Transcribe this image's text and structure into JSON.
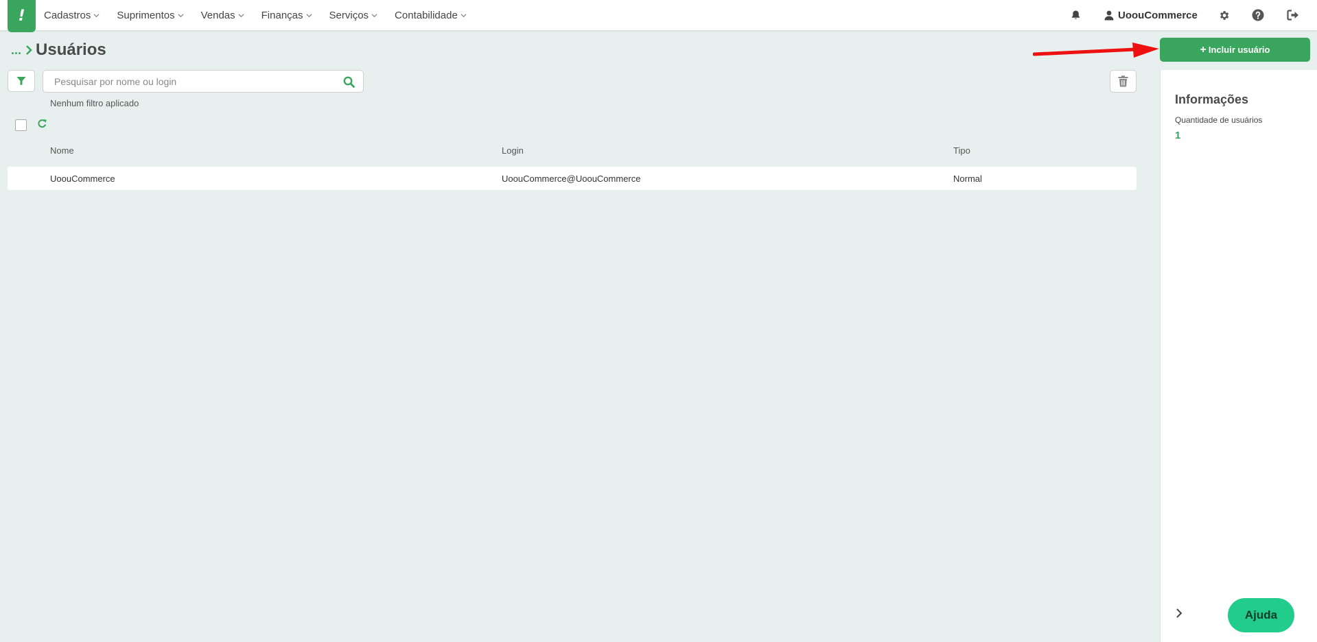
{
  "app": {
    "logo_glyph": "!"
  },
  "nav": {
    "menu": [
      {
        "label": "Cadastros"
      },
      {
        "label": "Suprimentos"
      },
      {
        "label": "Vendas"
      },
      {
        "label": "Finanças"
      },
      {
        "label": "Serviços"
      },
      {
        "label": "Contabilidade"
      }
    ],
    "user_name": "UoouCommerce",
    "icons": [
      "bell-icon",
      "user-icon",
      "gear-icon",
      "help-circle-icon",
      "logout-icon"
    ]
  },
  "page": {
    "breadcrumb_dots": "...",
    "title": "Usuários",
    "add_button_label": "Incluir usuário",
    "add_button_plus": "+"
  },
  "search": {
    "placeholder": "Pesquisar por nome ou login",
    "value": ""
  },
  "filter_status": "Nenhum filtro aplicado",
  "table": {
    "columns": [
      "Nome",
      "Login",
      "Tipo"
    ],
    "rows": [
      {
        "nome": "UoouCommerce",
        "login": "UoouCommerce@UoouCommerce",
        "tipo": "Normal"
      }
    ]
  },
  "side": {
    "title": "Informações",
    "qty_label": "Quantidade de usuários",
    "qty_value": "1",
    "help_label": "Ajuda"
  },
  "colors": {
    "brand_green": "#3aa55d",
    "help_green": "#22cc8a",
    "annotation_red": "#ee1111",
    "background": "#e7f0ee"
  }
}
